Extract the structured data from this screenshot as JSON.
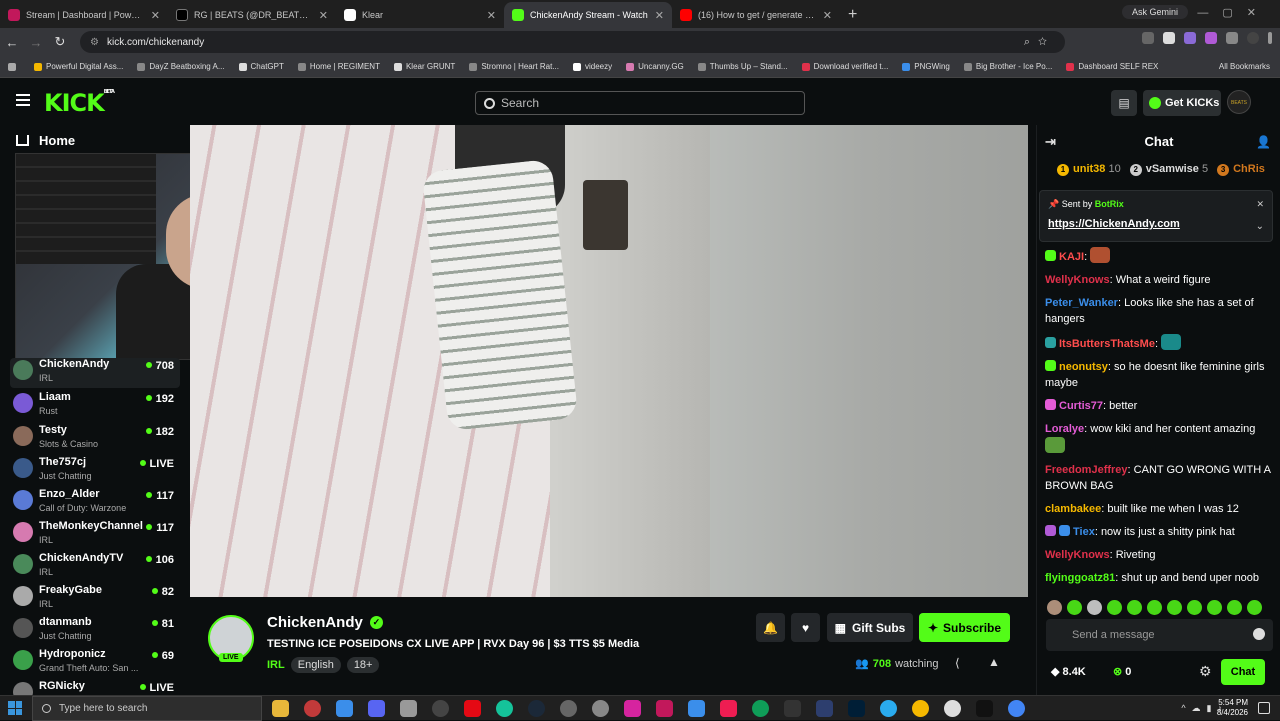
{
  "browser": {
    "tabs": [
      {
        "title": "Stream | Dashboard | PowerIRL",
        "color": "#c2185b"
      },
      {
        "title": "RG | BEATS (@DR_BEATS_KICK)",
        "color": "#000000"
      },
      {
        "title": "Klear",
        "color": "#ffffff"
      },
      {
        "title": "ChickenAndy Stream - Watch",
        "color": "#53fc18"
      },
      {
        "title": "(16) How to get / generate a sp",
        "color": "#ff0000"
      }
    ],
    "new_tab": "+",
    "gemini": "Ask Gemini",
    "url": "kick.com/chickenandy",
    "bookmarks": [
      "Powerful Digital Ass...",
      "DayZ Beatboxing A...",
      "ChatGPT",
      "Home | REGIMENT",
      "Klear GRUNT",
      "Stromno | Heart Rat...",
      "videezy",
      "Uncanny.GG",
      "Thumbs Up – Stand...",
      "Download verified t...",
      "PNGWing",
      "Big Brother - Ice Po...",
      "Dashboard SELF REX"
    ],
    "all_bookmarks": "All Bookmarks"
  },
  "header": {
    "logo": "KICK",
    "logo_sup": "BETA",
    "search_placeholder": "Search",
    "get_kicks": "Get KICKs",
    "avatar_text": "BEATS"
  },
  "sidebar": {
    "home": "Home",
    "channels": [
      {
        "name": "ChickenAndy",
        "category": "IRL",
        "viewers": "708",
        "color": "#4a7a5a"
      },
      {
        "name": "Liaam",
        "category": "Rust",
        "viewers": "192",
        "color": "#7a5ad6"
      },
      {
        "name": "Testy",
        "category": "Slots & Casino",
        "viewers": "182",
        "color": "#8a6a5a"
      },
      {
        "name": "The757cj",
        "category": "Just Chatting",
        "viewers": "LIVE",
        "color": "#3a5a8a"
      },
      {
        "name": "Enzo_Alder",
        "category": "Call of Duty: Warzone",
        "viewers": "117",
        "color": "#5a7ad6"
      },
      {
        "name": "TheMonkeyChannel",
        "category": "IRL",
        "viewers": "117",
        "color": "#d67ab0"
      },
      {
        "name": "ChickenAndyTV",
        "category": "IRL",
        "viewers": "106",
        "color": "#4a8a5a"
      },
      {
        "name": "FreakyGabe",
        "category": "IRL",
        "viewers": "82",
        "color": "#aaaaaa"
      },
      {
        "name": "dtanmanb",
        "category": "Just Chatting",
        "viewers": "81",
        "color": "#555555"
      },
      {
        "name": "Hydroponicz",
        "category": "Grand Theft Auto: San ...",
        "viewers": "69",
        "color": "#3aa04a"
      },
      {
        "name": "RGNicky",
        "category": "",
        "viewers": "LIVE",
        "color": "#777777"
      }
    ]
  },
  "stream": {
    "channel": "ChickenAndy",
    "live": "LIVE",
    "title": "TESTING ICE POSEIDONs CX LIVE APP | RVX Day 96 | $3 TTS $5 Media",
    "category": "IRL",
    "tags": [
      "English",
      "18+"
    ],
    "gift_subs": "Gift Subs",
    "subscribe": "Subscribe",
    "watching_count": "708",
    "watching_label": "watching"
  },
  "chat": {
    "title": "Chat",
    "leaderboard": [
      {
        "rank": "1",
        "name": "unit38",
        "count": "10",
        "color": "#f5b800"
      },
      {
        "rank": "2",
        "name": "vSamwise",
        "count": "5",
        "color": "#cccccc"
      },
      {
        "rank": "3",
        "name": "ChRis",
        "count": "",
        "color": "#d2781e"
      }
    ],
    "pinned": {
      "sent_by": "Sent by",
      "bot": "BotRix",
      "link": "https://ChickenAndy.com"
    },
    "messages": [
      {
        "user": "KAJI",
        "color": "#ff4d4d",
        "text": ""
      },
      {
        "user": "WellyKnows",
        "color": "#e0314b",
        "text": "What a weird figure"
      },
      {
        "user": "Peter_Wanker",
        "color": "#3b8eea",
        "text": "Looks like she has a set of hangers"
      },
      {
        "user": "ItsButtersThatsMe",
        "color": "#ff4d4d",
        "text": ""
      },
      {
        "user": "neonutsy",
        "color": "#f5b800",
        "text": "so he doesnt like feminine girls maybe"
      },
      {
        "user": "Curtis77",
        "color": "#e45cd6",
        "text": "better"
      },
      {
        "user": "Loralye",
        "color": "#e45cd6",
        "text": "wow kiki and her content amazing"
      },
      {
        "user": "FreedomJeffrey",
        "color": "#e0314b",
        "text": "CANT GO WRONG WITH A BROWN BAG"
      },
      {
        "user": "clambakee",
        "color": "#f5b800",
        "text": "built like me when I was 12"
      },
      {
        "user": "Tiex",
        "color": "#3b8eea",
        "text": "now its just a shitty pink hat"
      },
      {
        "user": "WellyKnows",
        "color": "#e0314b",
        "text": "Riveting"
      },
      {
        "user": "flyinggoatz81",
        "color": "#53fc18",
        "text": "shut up and bend uper noob"
      }
    ],
    "input_placeholder": "Send a message",
    "kicks": "8.4K",
    "kicks2": "0",
    "send": "Chat"
  },
  "taskbar": {
    "search": "Type here to search",
    "time": "5:54 PM",
    "date": "8/4/2026"
  }
}
